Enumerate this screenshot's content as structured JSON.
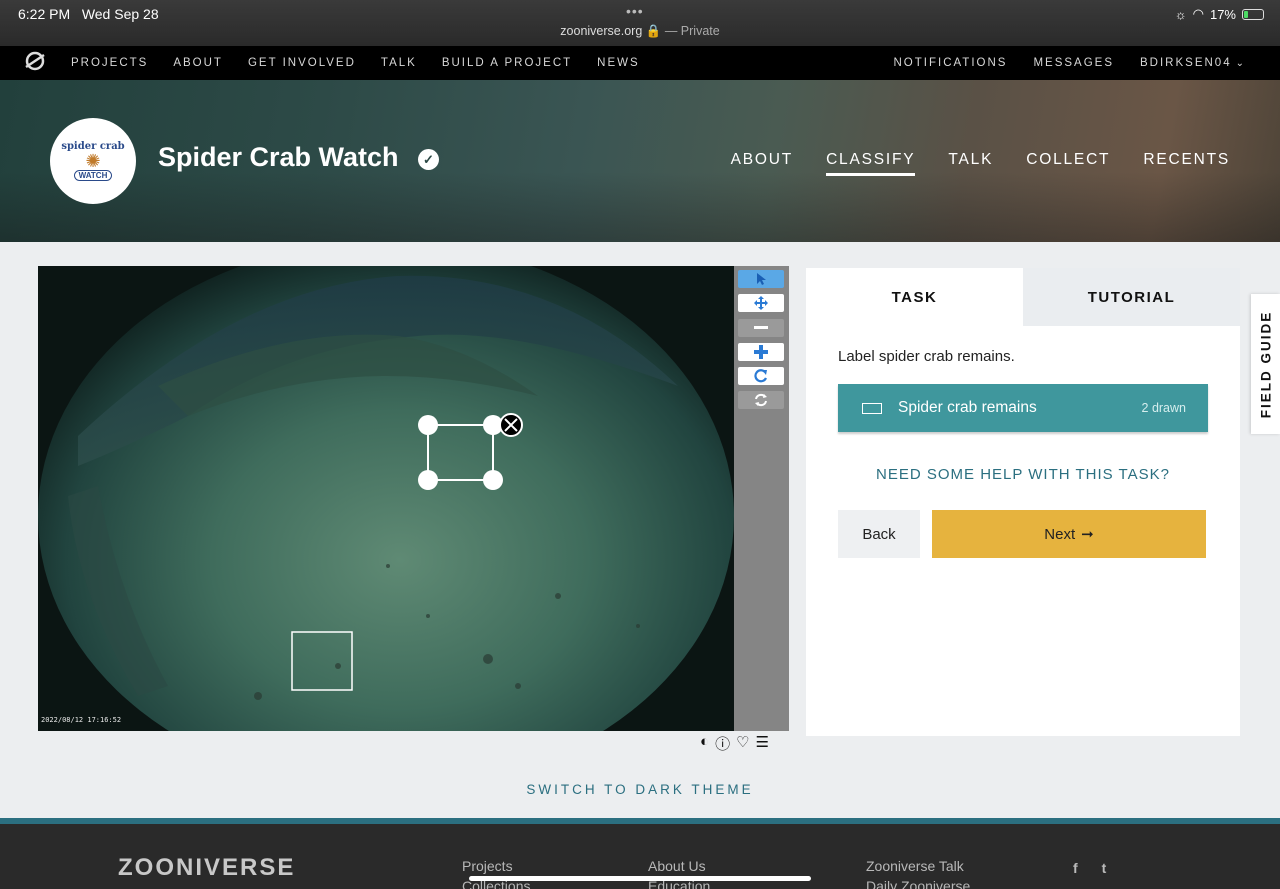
{
  "status_bar": {
    "time": "6:22 PM",
    "date": "Wed Sep 28",
    "url": "zooniverse.org",
    "private_label": "— Private",
    "battery": "17%"
  },
  "top_nav": {
    "left_items": [
      "PROJECTS",
      "ABOUT",
      "GET INVOLVED",
      "TALK",
      "BUILD A PROJECT",
      "NEWS"
    ],
    "right_items": [
      "NOTIFICATIONS",
      "MESSAGES"
    ],
    "username": "BDIRKSEN04"
  },
  "project": {
    "title": "Spider Crab Watch",
    "avatar_top": "spider crab",
    "avatar_bottom": "WATCH",
    "nav": [
      {
        "label": "ABOUT",
        "active": false
      },
      {
        "label": "CLASSIFY",
        "active": true
      },
      {
        "label": "TALK",
        "active": false
      },
      {
        "label": "COLLECT",
        "active": false
      },
      {
        "label": "RECENTS",
        "active": false
      }
    ]
  },
  "subject": {
    "timestamp": "2022/08/12 17:16:52"
  },
  "task_panel": {
    "tab_task": "TASK",
    "tab_tutorial": "TUTORIAL",
    "instruction": "Label spider crab remains.",
    "tool_label": "Spider crab remains",
    "tool_count": "2 drawn",
    "help_text": "NEED SOME HELP WITH THIS TASK?",
    "back_label": "Back",
    "next_label": "Next"
  },
  "field_guide_label": "FIELD GUIDE",
  "dark_theme_label": "SWITCH TO DARK THEME",
  "footer": {
    "logo_text": "ZOONIVERSE",
    "col1": [
      "Projects",
      "Collections"
    ],
    "col2": [
      "About Us",
      "Education"
    ],
    "col3": [
      "Zooniverse Talk",
      "Daily Zooniverse"
    ]
  },
  "colors": {
    "accent_teal": "#3f979d",
    "next_yellow": "#e6b33e",
    "link_teal": "#2b6f80"
  }
}
